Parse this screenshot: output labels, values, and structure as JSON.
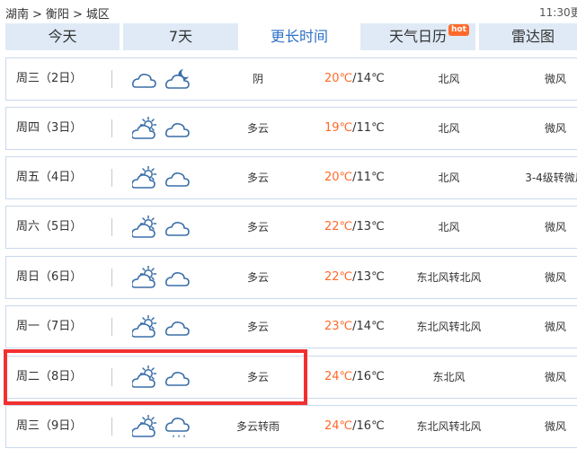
{
  "breadcrumb": {
    "province": "湖南",
    "city": "衡阳",
    "district": "城区",
    "separator": ">"
  },
  "update_time": "11:30更",
  "tabs": [
    {
      "label": "今天",
      "active": false
    },
    {
      "label": "7天",
      "active": false
    },
    {
      "label": "更长时间",
      "active": true
    },
    {
      "label": "天气日历",
      "active": false,
      "badge": "hot"
    },
    {
      "label": "雷达图",
      "active": false
    }
  ],
  "colors": {
    "accent": "#2e71c7",
    "high_temp": "#ff6a2b",
    "tab_bg": "#dfeaf6",
    "row_border": "#c9d9ec",
    "highlight": "#f23030",
    "icon_stroke": "#3a6ea8"
  },
  "forecast": [
    {
      "date": "周三（2日）",
      "day_icon": "cloudy-icon",
      "night_icon": "cloudy-moon-icon",
      "condition": "阴",
      "high": "20℃",
      "low": "/14℃",
      "wind_dir": "北风",
      "wind_level": "微风"
    },
    {
      "date": "周四（3日）",
      "day_icon": "partly-cloudy-sun-icon",
      "night_icon": "cloudy-icon",
      "condition": "多云",
      "high": "19℃",
      "low": "/11℃",
      "wind_dir": "北风",
      "wind_level": "微风"
    },
    {
      "date": "周五（4日）",
      "day_icon": "partly-cloudy-sun-icon",
      "night_icon": "cloudy-icon",
      "condition": "多云",
      "high": "20℃",
      "low": "/11℃",
      "wind_dir": "北风",
      "wind_level": "3-4级转微风"
    },
    {
      "date": "周六（5日）",
      "day_icon": "partly-cloudy-sun-icon",
      "night_icon": "cloudy-icon",
      "condition": "多云",
      "high": "22℃",
      "low": "/13℃",
      "wind_dir": "北风",
      "wind_level": "微风"
    },
    {
      "date": "周日（6日）",
      "day_icon": "partly-cloudy-sun-icon",
      "night_icon": "cloudy-icon",
      "condition": "多云",
      "high": "22℃",
      "low": "/13℃",
      "wind_dir": "东北风转北风",
      "wind_level": "微风"
    },
    {
      "date": "周一（7日）",
      "day_icon": "partly-cloudy-sun-icon",
      "night_icon": "cloudy-icon",
      "condition": "多云",
      "high": "23℃",
      "low": "/14℃",
      "wind_dir": "东北风转北风",
      "wind_level": "微风"
    },
    {
      "date": "周二（8日）",
      "day_icon": "partly-cloudy-sun-icon",
      "night_icon": "cloudy-icon",
      "condition": "多云",
      "high": "24℃",
      "low": "/16℃",
      "wind_dir": "东北风",
      "wind_level": "微风",
      "highlighted": true
    },
    {
      "date": "周三（9日）",
      "day_icon": "partly-cloudy-sun-icon",
      "night_icon": "rain-cloud-icon",
      "condition": "多云转雨",
      "high": "24℃",
      "low": "/16℃",
      "wind_dir": "东北风转北风",
      "wind_level": "微风"
    }
  ]
}
